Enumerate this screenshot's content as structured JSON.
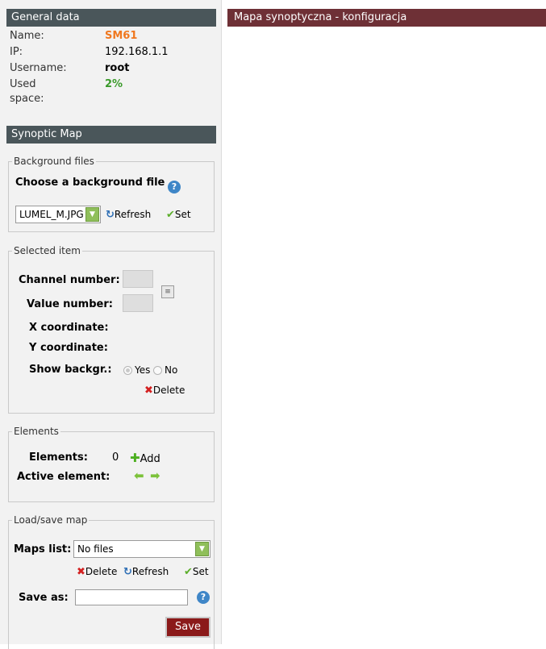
{
  "general": {
    "title": "General data",
    "name_label": "Name:",
    "name_value": "SM61",
    "ip_label": "IP:",
    "ip_value": "192.168.1.1",
    "username_label": "Username:",
    "username_value": "root",
    "used_space_label": "Used space:",
    "used_space_value": "2%",
    "name_color": "#f07820",
    "used_space_color": "#3a9a2a"
  },
  "synoptic": {
    "title": "Synoptic Map",
    "background": {
      "legend": "Background files",
      "choose_label": "Choose a background file",
      "selected_file": "LUMEL_M.JPG",
      "refresh_label": "Refresh",
      "set_label": "Set"
    },
    "selected_item": {
      "legend": "Selected item",
      "channel_label": "Channel number:",
      "value_label": "Value number:",
      "x_label": "X coordinate:",
      "y_label": "Y coordinate:",
      "show_bg_label": "Show backgr.:",
      "yes_label": "Yes",
      "no_label": "No",
      "delete_label": "Delete"
    },
    "elements": {
      "legend": "Elements",
      "elements_label": "Elements:",
      "elements_count": "0",
      "add_label": "Add",
      "active_label": "Active element:"
    },
    "load_save": {
      "legend": "Load/save map",
      "maps_label": "Maps list:",
      "maps_selected": "No files",
      "delete_label": "Delete",
      "refresh_label": "Refresh",
      "set_label": "Set",
      "save_as_label": "Save as:",
      "save_as_value": "",
      "save_button": "Save"
    }
  },
  "main": {
    "title": "Mapa synoptyczna - konfiguracja",
    "header_color": "#6e3036"
  },
  "icons": {
    "help": "help-icon",
    "refresh": "refresh-icon",
    "set": "checkmark-icon",
    "delete": "x-icon",
    "add": "plus-icon",
    "prev": "arrow-left-icon",
    "next": "arrow-right-icon",
    "picker": "list-picker-icon"
  }
}
